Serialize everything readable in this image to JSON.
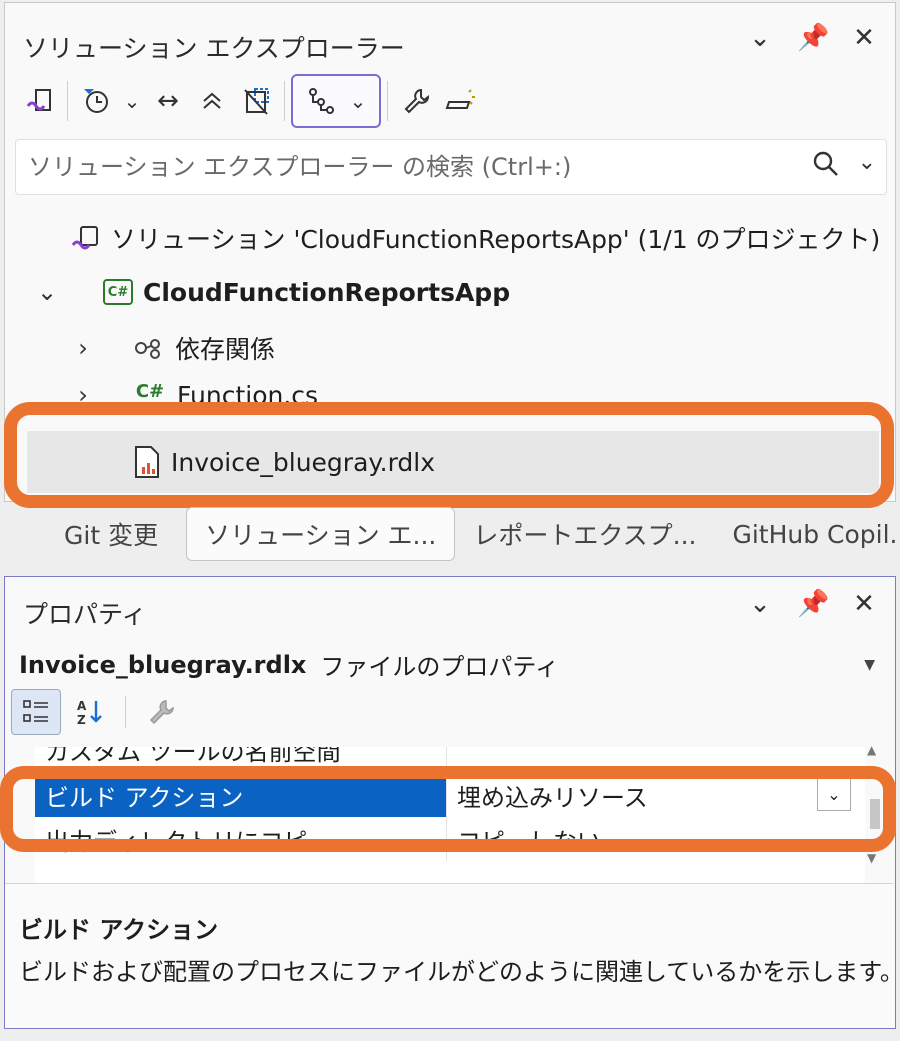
{
  "solution_explorer": {
    "title": "ソリューション エクスプローラー",
    "search_placeholder": "ソリューション エクスプローラー の検索 (Ctrl+:)",
    "tree": {
      "solution": "ソリューション 'CloudFunctionReportsApp' (1/1 のプロジェクト)",
      "project": "CloudFunctionReportsApp",
      "dependencies": "依存関係",
      "function_file": "Function.cs",
      "selected_file": "Invoice_bluegray.rdlx"
    }
  },
  "tabs": [
    {
      "label": "Git 変更"
    },
    {
      "label": "ソリューション エ..."
    },
    {
      "label": "レポートエクスプ..."
    },
    {
      "label": "GitHub Copil..."
    }
  ],
  "properties": {
    "title": "プロパティ",
    "object_name": "Invoice_bluegray.rdlx",
    "object_type": "ファイルのプロパティ",
    "rows": [
      {
        "name": "カスタム ツールの名前空間",
        "value": ""
      },
      {
        "name": "ビルド アクション",
        "value": "埋め込みリソース"
      },
      {
        "name": "出力ディレクトリにコピー",
        "value": "コピーしない"
      }
    ],
    "description_title": "ビルド アクション",
    "description_text": "ビルドおよび配置のプロセスにファイルがどのように関連しているかを示します。"
  },
  "colors": {
    "highlight": "#ea7330",
    "selection": "#0a63c3"
  }
}
